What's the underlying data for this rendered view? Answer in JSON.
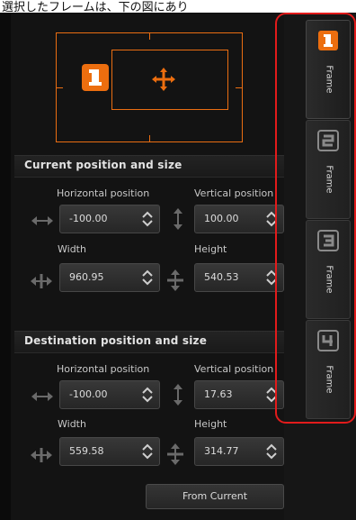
{
  "header": {
    "text": "選択したフレームは、下の図にあり"
  },
  "preview": {
    "frame_number": "1"
  },
  "current": {
    "title": "Current position and size",
    "horizontal_label": "Horizontal position",
    "vertical_label": "Vertical position",
    "width_label": "Width",
    "height_label": "Height",
    "horizontal_value": "-100.00",
    "vertical_value": "100.00",
    "width_value": "960.95",
    "height_value": "540.53"
  },
  "destination": {
    "title": "Destination position and size",
    "horizontal_label": "Horizontal position",
    "vertical_label": "Vertical position",
    "width_label": "Width",
    "height_label": "Height",
    "horizontal_value": "-100.00",
    "vertical_value": "17.63",
    "width_value": "559.58",
    "height_value": "314.77"
  },
  "from_current_button": "From Current",
  "tabs": [
    {
      "number": "1",
      "label": "Frame",
      "active": true
    },
    {
      "number": "2",
      "label": "Frame",
      "active": false
    },
    {
      "number": "3",
      "label": "Frame",
      "active": false
    },
    {
      "number": "4",
      "label": "Frame",
      "active": false
    }
  ],
  "colors": {
    "accent": "#ec6e0f",
    "highlight": "#e21b1b"
  }
}
